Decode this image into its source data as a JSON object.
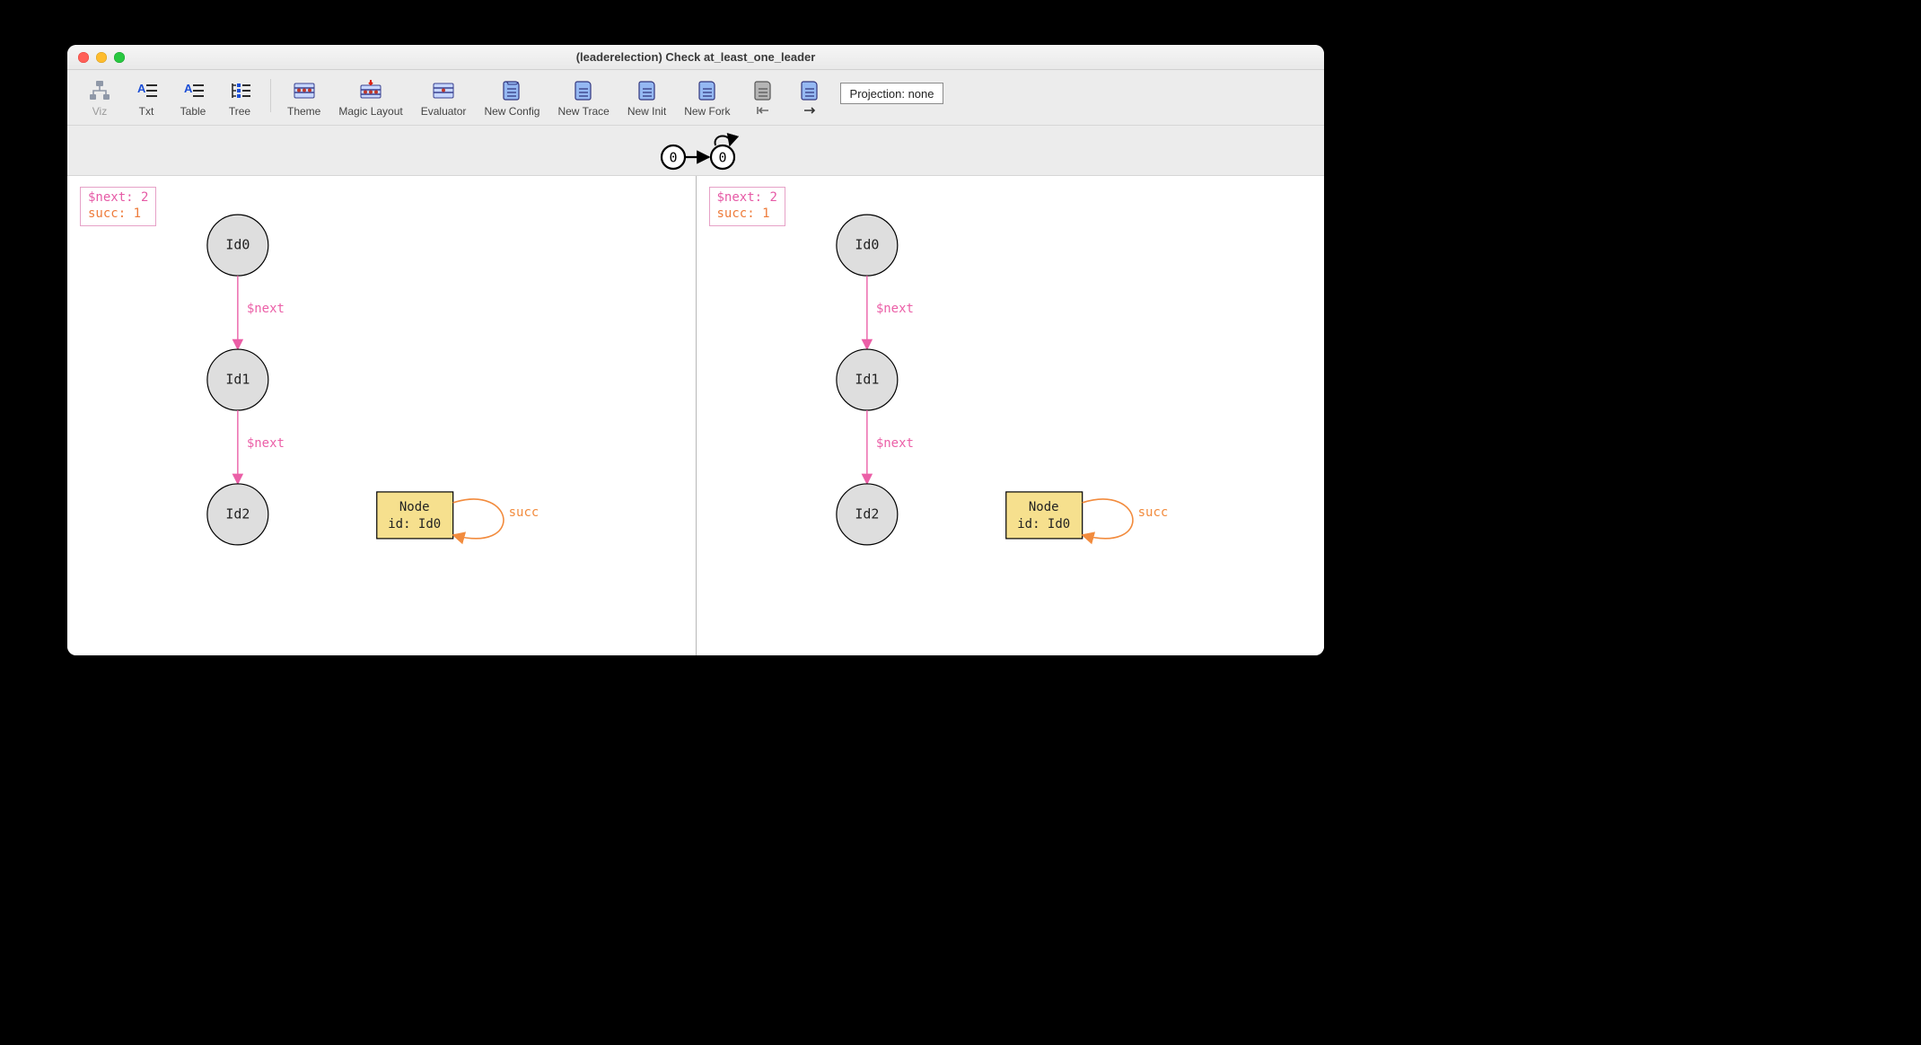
{
  "window": {
    "title": "(leaderelection) Check at_least_one_leader"
  },
  "toolbar": {
    "items": [
      {
        "id": "viz",
        "label": "Viz"
      },
      {
        "id": "txt",
        "label": "Txt"
      },
      {
        "id": "table",
        "label": "Table"
      },
      {
        "id": "tree",
        "label": "Tree"
      },
      {
        "id": "theme",
        "label": "Theme"
      },
      {
        "id": "magic-layout",
        "label": "Magic Layout"
      },
      {
        "id": "evaluator",
        "label": "Evaluator"
      },
      {
        "id": "new-config",
        "label": "New Config"
      },
      {
        "id": "new-trace",
        "label": "New Trace"
      },
      {
        "id": "new-init",
        "label": "New Init"
      },
      {
        "id": "new-fork",
        "label": "New Fork"
      },
      {
        "id": "nav-first",
        "label": "⤒"
      },
      {
        "id": "nav-next",
        "label": "→"
      }
    ],
    "projection_label": "Projection: none"
  },
  "trace": {
    "states": [
      "0",
      "0"
    ],
    "loop_on_index": 1
  },
  "legend": {
    "line1": "$next: 2",
    "line2": "succ: 1"
  },
  "graph": {
    "id_nodes": [
      "Id0",
      "Id1",
      "Id2"
    ],
    "edge_label": "$next",
    "rect_node": {
      "line1": "Node",
      "line2": "id: Id0",
      "self_loop_label": "succ"
    }
  }
}
